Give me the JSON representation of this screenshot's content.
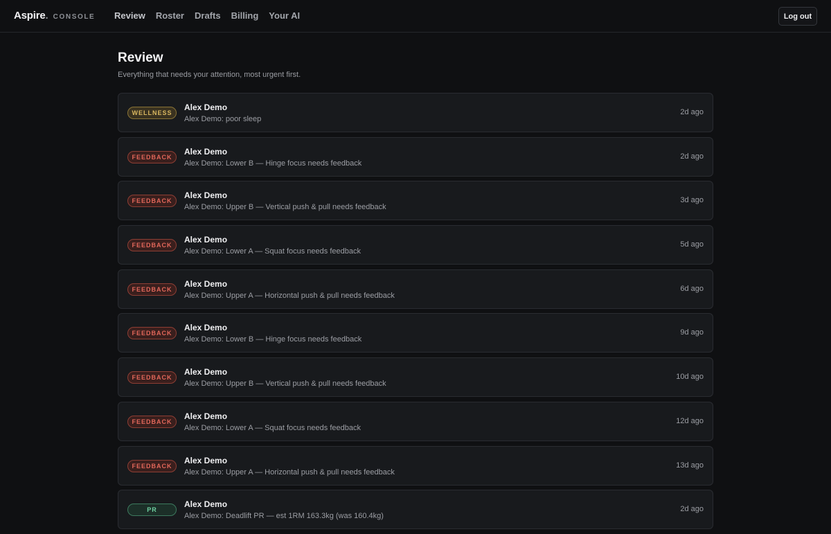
{
  "header": {
    "brand_name": "Aspire",
    "brand_dot": ".",
    "brand_sub": "CONSOLE",
    "nav": [
      "Review",
      "Roster",
      "Drafts",
      "Billing",
      "Your AI"
    ],
    "logout_label": "Log out"
  },
  "page": {
    "title": "Review",
    "subtitle": "Everything that needs your attention, most urgent first."
  },
  "items": [
    {
      "tag": "WELLNESS",
      "kind": "wellness",
      "name": "Alex Demo",
      "detail": "Alex Demo: poor sleep",
      "time": "2d ago"
    },
    {
      "tag": "FEEDBACK",
      "kind": "feedback",
      "name": "Alex Demo",
      "detail": "Alex Demo: Lower B — Hinge focus needs feedback",
      "time": "2d ago"
    },
    {
      "tag": "FEEDBACK",
      "kind": "feedback",
      "name": "Alex Demo",
      "detail": "Alex Demo: Upper B — Vertical push & pull needs feedback",
      "time": "3d ago"
    },
    {
      "tag": "FEEDBACK",
      "kind": "feedback",
      "name": "Alex Demo",
      "detail": "Alex Demo: Lower A — Squat focus needs feedback",
      "time": "5d ago"
    },
    {
      "tag": "FEEDBACK",
      "kind": "feedback",
      "name": "Alex Demo",
      "detail": "Alex Demo: Upper A — Horizontal push & pull needs feedback",
      "time": "6d ago"
    },
    {
      "tag": "FEEDBACK",
      "kind": "feedback",
      "name": "Alex Demo",
      "detail": "Alex Demo: Lower B — Hinge focus needs feedback",
      "time": "9d ago"
    },
    {
      "tag": "FEEDBACK",
      "kind": "feedback",
      "name": "Alex Demo",
      "detail": "Alex Demo: Upper B — Vertical push & pull needs feedback",
      "time": "10d ago"
    },
    {
      "tag": "FEEDBACK",
      "kind": "feedback",
      "name": "Alex Demo",
      "detail": "Alex Demo: Lower A — Squat focus needs feedback",
      "time": "12d ago"
    },
    {
      "tag": "FEEDBACK",
      "kind": "feedback",
      "name": "Alex Demo",
      "detail": "Alex Demo: Upper A — Horizontal push & pull needs feedback",
      "time": "13d ago"
    },
    {
      "tag": "PR",
      "kind": "pr",
      "name": "Alex Demo",
      "detail": "Alex Demo: Deadlift PR — est 1RM 163.3kg (was 160.4kg)",
      "time": "2d ago"
    }
  ]
}
